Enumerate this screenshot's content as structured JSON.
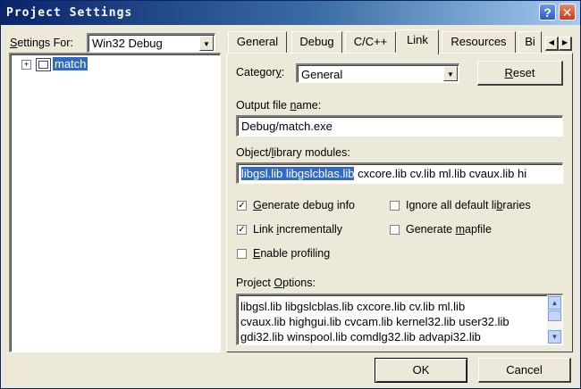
{
  "window": {
    "title": "Project Settings"
  },
  "left": {
    "settings_for_label": "Settings For:",
    "settings_for_value": "Win32 Debug",
    "tree": {
      "expander": "+",
      "item": "match"
    }
  },
  "tabs": [
    {
      "label": "General"
    },
    {
      "label": "Debug"
    },
    {
      "label": "C/C++"
    },
    {
      "label": "Link"
    },
    {
      "label": "Resources"
    },
    {
      "label": "Bi"
    }
  ],
  "link": {
    "category_label": "Category:",
    "category_value": "General",
    "reset_label": "Reset",
    "output_label": "Output file name:",
    "output_value": "Debug/match.exe",
    "modules_label": "Object/library modules:",
    "modules_selected": "libgsl.lib libgslcblas.lib",
    "modules_rest": " cxcore.lib cv.lib ml.lib cvaux.lib hi",
    "checks": [
      {
        "label": "Generate debug info",
        "checked": true
      },
      {
        "label": "Ignore all default libraries",
        "checked": false
      },
      {
        "label": "Link incrementally",
        "checked": true
      },
      {
        "label": "Generate mapfile",
        "checked": false
      },
      {
        "label": "Enable profiling",
        "checked": false
      }
    ],
    "project_options_label": "Project Options:",
    "project_options_lines": [
      "libgsl.lib libgslcblas.lib cxcore.lib cv.lib ml.lib",
      "cvaux.lib highgui.lib cvcam.lib kernel32.lib user32.lib",
      "gdi32.lib winspool.lib comdlg32.lib advapi32.lib"
    ]
  },
  "footer": {
    "ok_label": "OK",
    "cancel_label": "Cancel"
  }
}
